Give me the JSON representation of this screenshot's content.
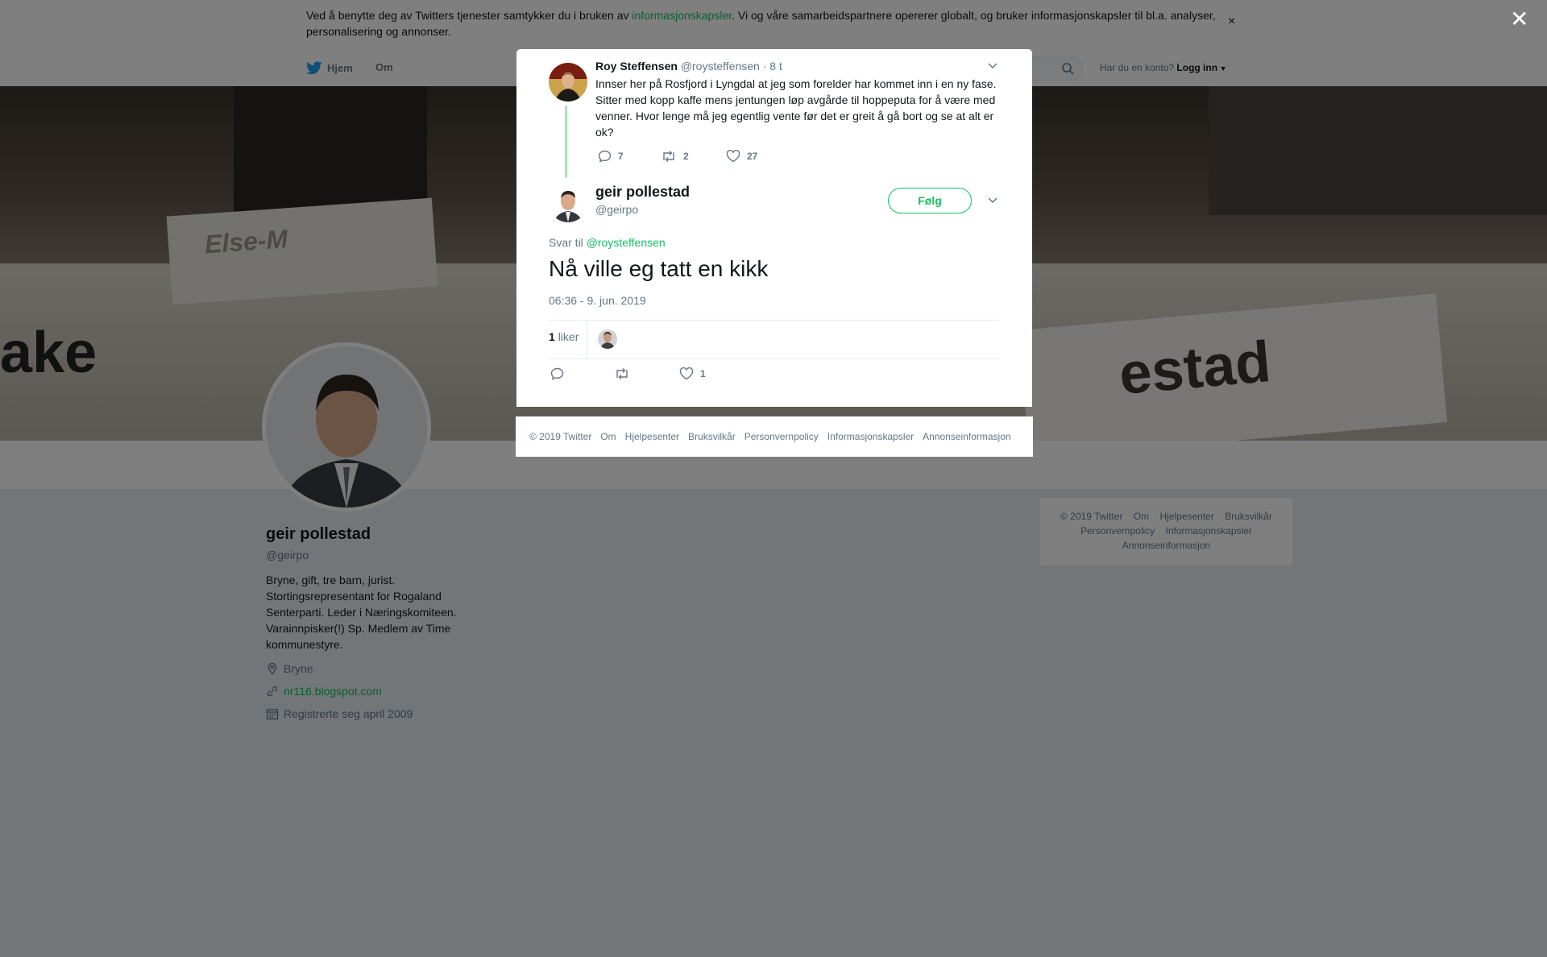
{
  "cookie_banner": {
    "text_before": "Ved å benytte deg av Twitters tjenester samtykker du i bruken av ",
    "link": "informasjonskapsler",
    "text_after": ". Vi og våre samarbeidspartnere opererer globalt, og bruker informasjonskapsler til bl.a. analyser, personalisering og annonser.",
    "close": "×"
  },
  "nav": {
    "home": "Hjem",
    "about": "Om",
    "login_prompt": "Har du en konto?",
    "login": "Logg inn"
  },
  "banner": {
    "card_left": "Else-M",
    "card_right": "estad",
    "card_far_left": "ake"
  },
  "profile": {
    "name": "geir pollestad",
    "handle": "@geirpo",
    "bio": "Bryne, gift, tre barn, jurist. Stortingsrepresentant for Rogaland Senterparti. Leder i Næringskomiteen. Varainnpisker(!) Sp. Medlem av Time kommunestyre.",
    "location": "Bryne",
    "url": "nr116.blogspot.com",
    "joined": "Registrerte seg april 2009"
  },
  "side_footer": {
    "row1": [
      "© 2019 Twitter",
      "Om",
      "Hjelpesenter",
      "Bruksvilkår"
    ],
    "row2": [
      "Personvernpolicy",
      "Informasjonskapsler"
    ],
    "row3": [
      "Annonseinformasjon"
    ]
  },
  "overlay": {
    "close": "✕"
  },
  "parent_tweet": {
    "name": "Roy Steffensen",
    "handle": "@roysteffensen",
    "time": "· 8 t",
    "text": "Innser her på Rosfjord i Lyngdal at jeg som forelder har kommet inn i en ny fase. Sitter med kopp kaffe mens jentungen løp avgårde til hoppeputa for å være med venner. Hvor lenge må jeg egentlig vente før det er greit å gå bort og se at alt er ok?",
    "replies": "7",
    "retweets": "2",
    "likes": "27"
  },
  "main_tweet": {
    "name": "geir pollestad",
    "handle": "@geirpo",
    "follow": "Følg",
    "reply_to_label": "Svar til",
    "reply_to_handle": "@roysteffensen",
    "text": "Nå ville eg tatt en kikk",
    "timestamp": "06:36 - 9. jun. 2019",
    "likes_count": "1",
    "likes_label": "liker",
    "action_likes": "1"
  },
  "modal_footer": [
    "© 2019 Twitter",
    "Om",
    "Hjelpesenter",
    "Bruksvilkår",
    "Personvernpolicy",
    "Informasjonskapsler",
    "Annonseinformasjon"
  ],
  "colors": {
    "accent": "#17bf63",
    "twitter_blue": "#1da1f2",
    "muted": "#657786"
  }
}
